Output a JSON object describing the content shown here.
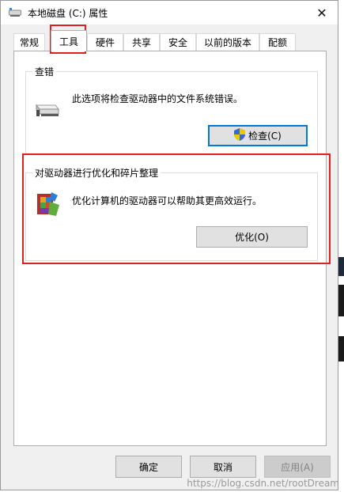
{
  "window": {
    "title": "本地磁盘 (C:) 属性",
    "close_symbol": "✕"
  },
  "tabs": [
    {
      "label": "常规"
    },
    {
      "label": "工具"
    },
    {
      "label": "硬件"
    },
    {
      "label": "共享"
    },
    {
      "label": "安全"
    },
    {
      "label": "以前的版本"
    },
    {
      "label": "配额"
    }
  ],
  "check_group": {
    "title": "查错",
    "description": "此选项将检查驱动器中的文件系统错误。",
    "button_label": "检查(C)"
  },
  "optimize_group": {
    "title": "对驱动器进行优化和碎片整理",
    "description": "优化计算机的驱动器可以帮助其更高效运行。",
    "button_label": "优化(O)"
  },
  "footer": {
    "ok_label": "确定",
    "cancel_label": "取消",
    "apply_label": "应用(A)"
  },
  "watermark": "https://blog.csdn.net/rootDream"
}
